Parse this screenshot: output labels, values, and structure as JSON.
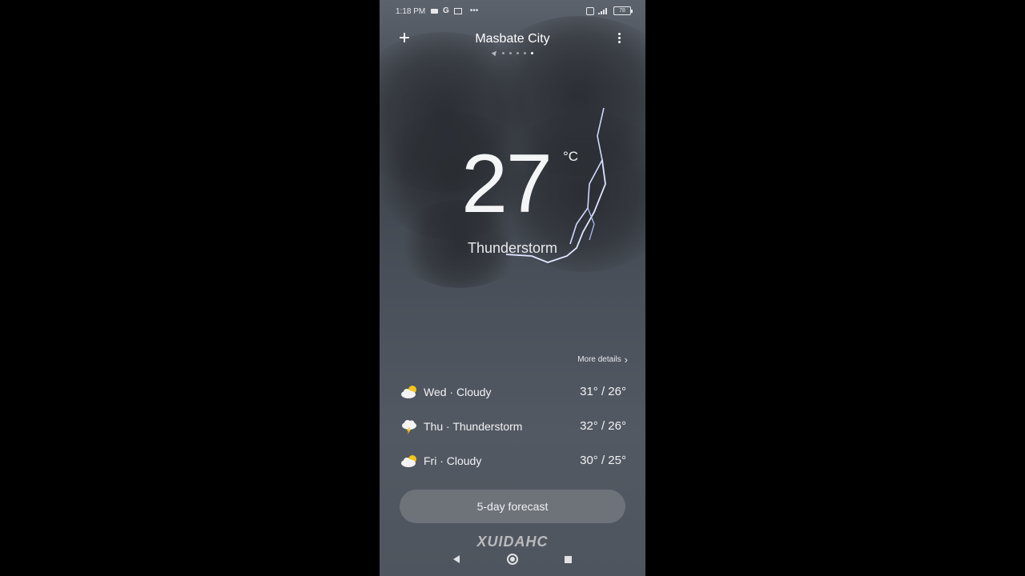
{
  "status_bar": {
    "time": "1:18 PM",
    "battery": "78"
  },
  "header": {
    "city": "Masbate City",
    "add_label": "+"
  },
  "current": {
    "temperature": "27",
    "unit": "°C",
    "condition": "Thunderstorm"
  },
  "more_details": {
    "label": "More details",
    "chevron": "›"
  },
  "forecast": [
    {
      "label": "Wed · Cloudy",
      "range": "31° / 26°",
      "icon": "cloudy-sun-icon"
    },
    {
      "label": "Thu · Thunderstorm",
      "range": "32° / 26°",
      "icon": "thunderstorm-icon"
    },
    {
      "label": "Fri · Cloudy",
      "range": "30° / 25°",
      "icon": "cloudy-sun-icon"
    }
  ],
  "five_day_button": {
    "label": "5-day forecast"
  },
  "watermark": "XUIDAHC",
  "colors": {
    "accent_sun": "#f5c518",
    "background": "#4a5059"
  }
}
